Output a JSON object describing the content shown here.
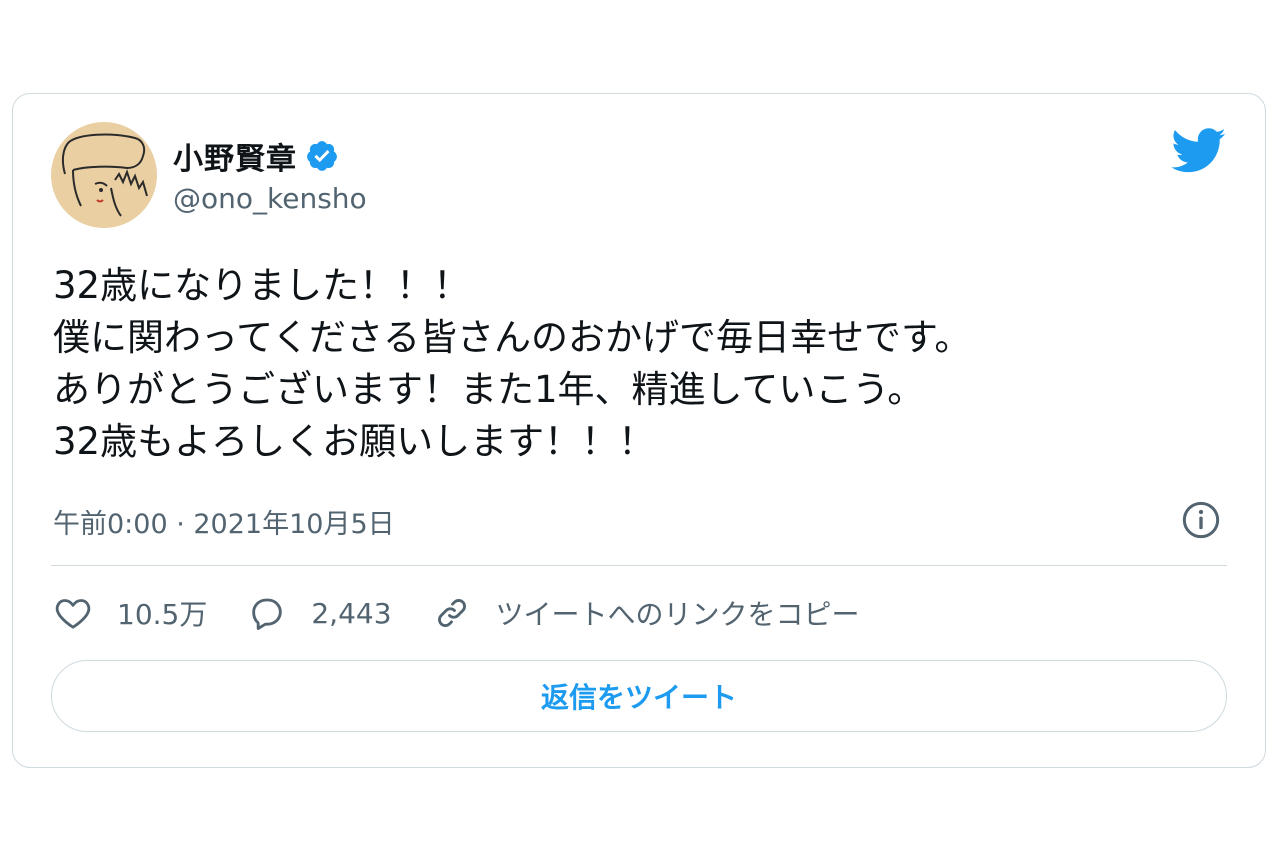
{
  "author": {
    "display_name": "小野賢章",
    "handle": "@ono_kensho",
    "verified": true
  },
  "tweet": {
    "lines": [
      "32歳になりました！！！",
      "僕に関わってくださる皆さんのおかげで毎日幸せです。",
      "ありがとうございます！また1年、精進していこう。",
      "32歳もよろしくお願いします！！！"
    ],
    "timestamp": "午前0:00 · 2021年10月5日"
  },
  "actions": {
    "likes": "10.5万",
    "replies": "2,443",
    "copy_link_label": "ツイートへのリンクをコピー"
  },
  "reply_button_label": "返信をツイート",
  "icons": {
    "brand": "twitter-bird-icon",
    "verified": "verified-badge-icon",
    "info": "info-icon",
    "like": "heart-icon",
    "reply": "speech-bubble-icon",
    "link": "link-icon"
  },
  "colors": {
    "accent": "#1d9bf0",
    "text": "#0f1419",
    "secondary_text": "#536471",
    "border": "#cfd9de",
    "avatar_bg": "#e9cfa2"
  }
}
